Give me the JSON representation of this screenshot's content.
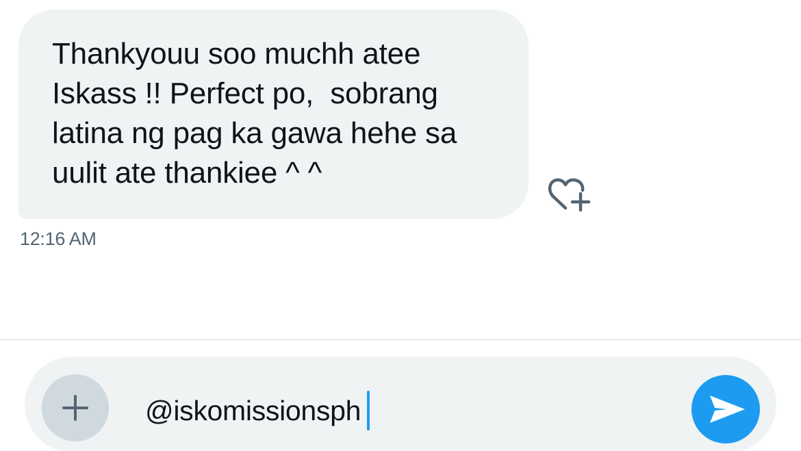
{
  "conversation": {
    "messages": [
      {
        "direction": "received",
        "lines": [
          "Thankyouu soo muchh atee",
          "Iskass !! Perfect po,  sobrang",
          "latina ng pag ka gawa hehe sa",
          "uulit ate thankiee ^ ^"
        ],
        "timestamp": "12:16 AM",
        "reaction_icon": "heart-plus-icon"
      }
    ]
  },
  "composer": {
    "add_icon": "plus-icon",
    "input_value": "@iskomissionsph",
    "send_icon": "send-arrow-icon"
  },
  "colors": {
    "bubble_background": "#eff3f4",
    "text_primary": "#0f1419",
    "text_secondary": "#536471",
    "accent": "#1d9bf0",
    "add_button_background": "#cfd9de"
  }
}
